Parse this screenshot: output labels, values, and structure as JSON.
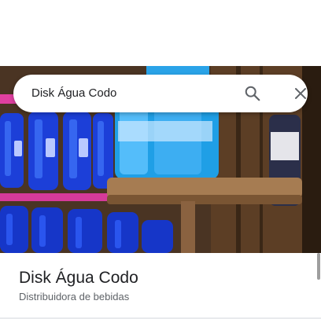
{
  "search": {
    "query": "Disk Água Codo"
  },
  "icons": {
    "search": "search-icon",
    "close": "close-icon"
  },
  "place": {
    "name": "Disk Água Codo",
    "category": "Distribuidora de bebidas"
  },
  "colors": {
    "water_jug_blue": "#1f4fe0",
    "wood_shelf": "#a67c52"
  }
}
